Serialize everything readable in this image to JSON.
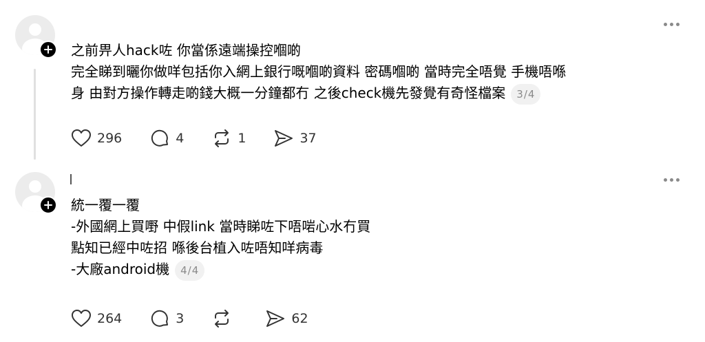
{
  "posts": [
    {
      "lines": [
        "之前畀人hack咗 你當係遠端操控嗰啲",
        "完全睇到曬你做咩包括你入網上銀行嘅嗰啲資料 密碼嗰啲 當時完全唔覺 手機唔喺",
        "身 由對方操作轉走啲錢大概一分鐘都冇 之後check機先發覺有奇怪檔案"
      ],
      "page": "3/4",
      "likes": "296",
      "replies": "4",
      "reposts": "1",
      "shares": "37"
    },
    {
      "lines": [
        "統一覆一覆",
        "-外國網上買嘢 中假link 當時睇咗下唔啱心水冇買",
        "點知已經中咗招 喺後台植入咗唔知咩病毒",
        "-大廠android機"
      ],
      "page": "4/4",
      "likes": "264",
      "replies": "3",
      "reposts": "",
      "shares": "62"
    }
  ],
  "icons": {
    "like": "heart-icon",
    "reply": "comment-icon",
    "repost": "repost-icon",
    "share": "send-icon",
    "more": "more-icon",
    "follow": "plus-icon"
  }
}
